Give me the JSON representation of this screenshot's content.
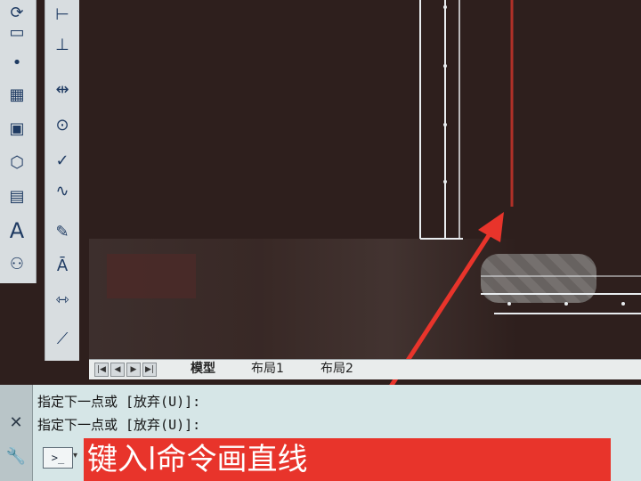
{
  "tabs": {
    "model": "模型",
    "layout1": "布局1",
    "layout2": "布局2"
  },
  "nav_buttons": [
    "|◀",
    "◀",
    "▶",
    "▶|"
  ],
  "command_window": {
    "lines": [
      "指定下一点或 [放弃(U)]:",
      "指定下一点或 [放弃(U)]:"
    ],
    "prompt_icon": ">_"
  },
  "caption": "键入l命令画直线",
  "colors": {
    "annotation_red": "#e8342b",
    "drawing_bg": "#2e1f1d",
    "cad_line_white": "#e8ecef",
    "cad_line_red": "#b03028",
    "command_bg": "#d6e6e7"
  },
  "left_toolbar_icons": [
    "revcloud-icon",
    "ellipse-icon",
    "point-icon",
    "hatch-icon",
    "gradient-icon",
    "region-icon",
    "table-icon",
    "multiline-text-icon",
    "add-selected-icon"
  ],
  "dim_toolbar_icons": [
    "dim-linear-icon",
    "dim-ordinate-icon",
    "dim-center-icon",
    "dim-baseline-icon",
    "dim-jogged-icon",
    "dim-edit-icon",
    "dim-text-edit-icon",
    "dim-update-icon",
    "dim-style-icon"
  ],
  "labels": {
    "text_icon": "A",
    "close_icon": "✕",
    "wrench_icon": "🔧"
  }
}
